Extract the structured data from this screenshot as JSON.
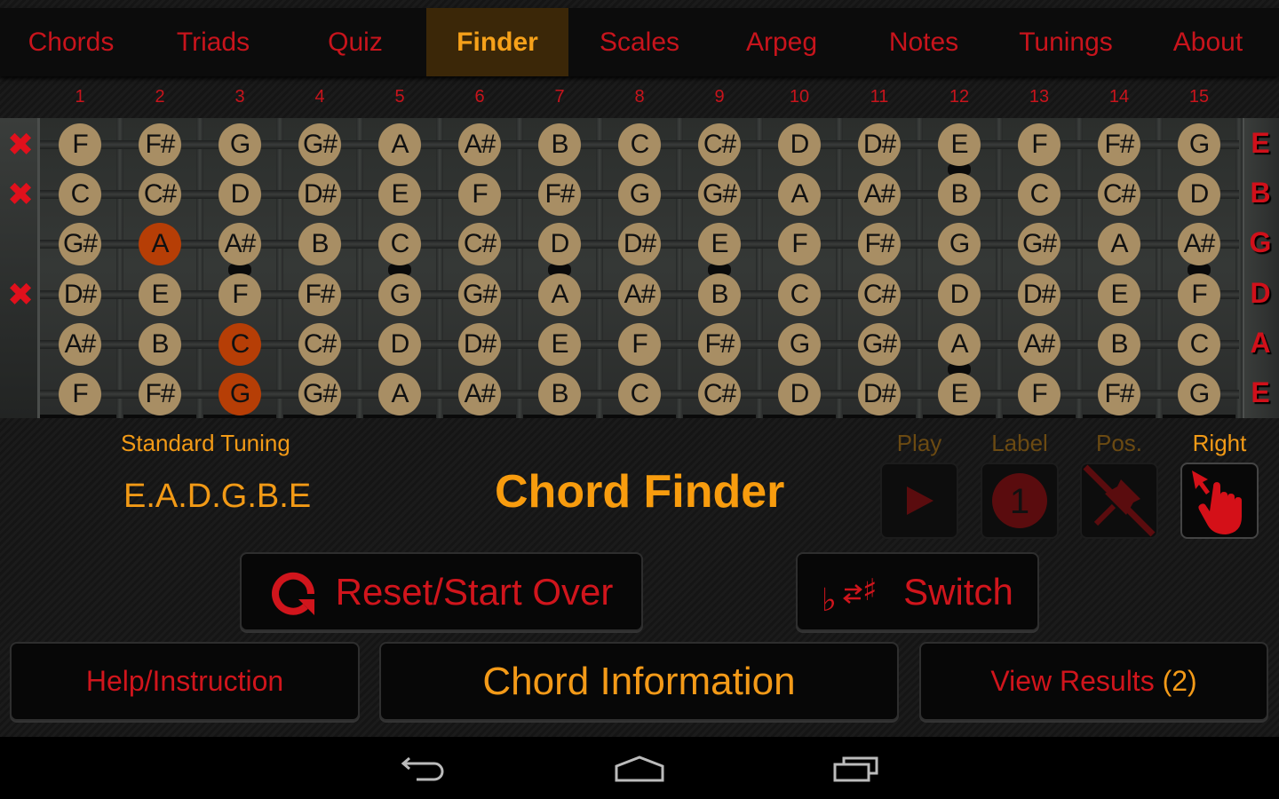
{
  "tabs": [
    {
      "label": "Chords",
      "active": false
    },
    {
      "label": "Triads",
      "active": false
    },
    {
      "label": "Quiz",
      "active": false
    },
    {
      "label": "Finder",
      "active": true
    },
    {
      "label": "Scales",
      "active": false
    },
    {
      "label": "Arpeg",
      "active": false
    },
    {
      "label": "Notes",
      "active": false
    },
    {
      "label": "Tunings",
      "active": false
    },
    {
      "label": "About",
      "active": false
    }
  ],
  "fret_numbers": [
    "1",
    "2",
    "3",
    "4",
    "5",
    "6",
    "7",
    "8",
    "9",
    "10",
    "11",
    "12",
    "13",
    "14",
    "15"
  ],
  "fretboard": {
    "strings": [
      {
        "name": "E",
        "muted": true,
        "selected_fret": null,
        "notes": [
          "F",
          "F#",
          "G",
          "G#",
          "A",
          "A#",
          "B",
          "C",
          "C#",
          "D",
          "D#",
          "E",
          "F",
          "F#",
          "G"
        ]
      },
      {
        "name": "B",
        "muted": true,
        "selected_fret": null,
        "notes": [
          "C",
          "C#",
          "D",
          "D#",
          "E",
          "F",
          "F#",
          "G",
          "G#",
          "A",
          "A#",
          "B",
          "C",
          "C#",
          "D"
        ]
      },
      {
        "name": "G",
        "muted": false,
        "selected_fret": 2,
        "notes": [
          "G#",
          "A",
          "A#",
          "B",
          "C",
          "C#",
          "D",
          "D#",
          "E",
          "F",
          "F#",
          "G",
          "G#",
          "A",
          "A#"
        ]
      },
      {
        "name": "D",
        "muted": true,
        "selected_fret": null,
        "notes": [
          "D#",
          "E",
          "F",
          "F#",
          "G",
          "G#",
          "A",
          "A#",
          "B",
          "C",
          "C#",
          "D",
          "D#",
          "E",
          "F"
        ]
      },
      {
        "name": "A",
        "muted": false,
        "selected_fret": 3,
        "notes": [
          "A#",
          "B",
          "C",
          "C#",
          "D",
          "D#",
          "E",
          "F",
          "F#",
          "G",
          "G#",
          "A",
          "A#",
          "B",
          "C"
        ]
      },
      {
        "name": "E",
        "muted": false,
        "selected_fret": 3,
        "notes": [
          "F",
          "F#",
          "G",
          "G#",
          "A",
          "A#",
          "B",
          "C",
          "C#",
          "D",
          "D#",
          "E",
          "F",
          "F#",
          "G"
        ]
      }
    ],
    "mute_icon": "x-mark",
    "fret_markers": [
      {
        "fret": 3,
        "between_strings": [
          3,
          4
        ]
      },
      {
        "fret": 5,
        "between_strings": [
          3,
          4
        ]
      },
      {
        "fret": 7,
        "between_strings": [
          3,
          4
        ]
      },
      {
        "fret": 9,
        "between_strings": [
          3,
          4
        ]
      },
      {
        "fret": 12,
        "between_strings": [
          1,
          2
        ]
      },
      {
        "fret": 12,
        "between_strings": [
          5,
          6
        ]
      },
      {
        "fret": 15,
        "between_strings": [
          3,
          4
        ]
      }
    ]
  },
  "tuning": {
    "label": "Standard Tuning",
    "value": "E.A.D.G.B.E"
  },
  "title": "Chord Finder",
  "options": [
    {
      "label": "Play",
      "icon": "play-icon",
      "enabled": false
    },
    {
      "label": "Label",
      "icon": "number-one-icon",
      "enabled": false
    },
    {
      "label": "Pos.",
      "icon": "pin-off-icon",
      "enabled": false
    },
    {
      "label": "Right",
      "icon": "hand-pointer-icon",
      "enabled": true
    }
  ],
  "buttons": {
    "reset": "Reset/Start Over",
    "switch": "Switch",
    "help": "Help/Instruction",
    "chord_info": "Chord Information",
    "view_results": "View Results",
    "results_count": "(2)"
  },
  "colors": {
    "accent_red": "#c8141c",
    "accent_orange": "#f39a18",
    "note_circle": "#a88e64",
    "note_selected": "#b63e06",
    "active_tab_bg": "#3b2708"
  }
}
